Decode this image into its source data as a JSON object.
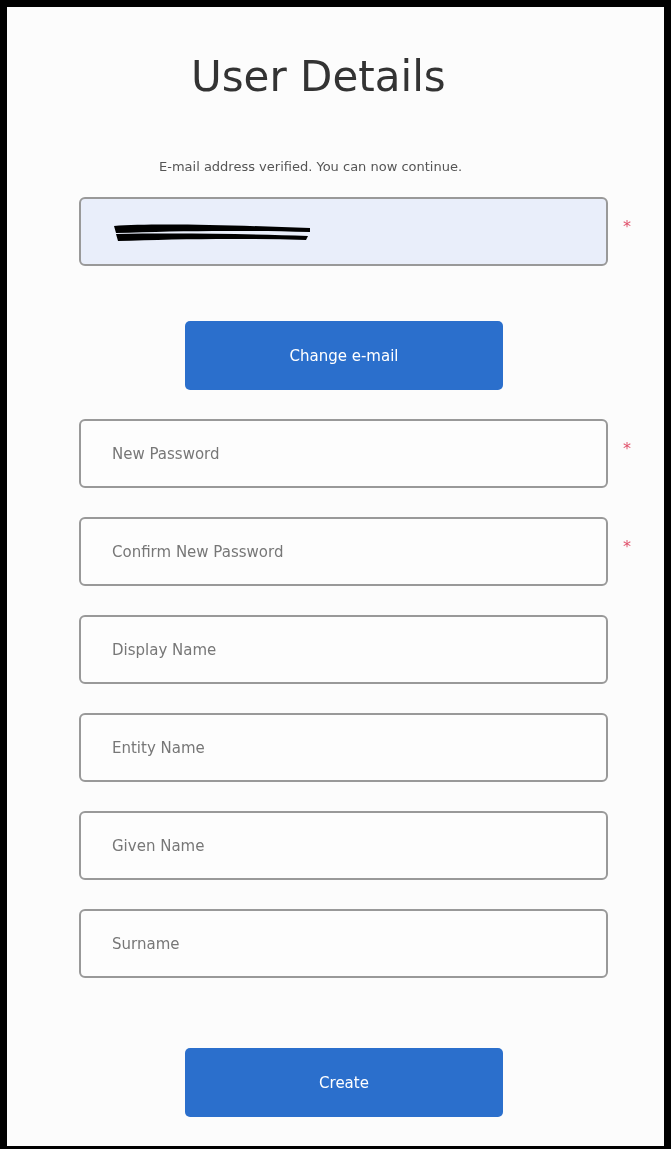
{
  "title": "User Details",
  "message": "E-mail address verified. You can now continue.",
  "email_field": {
    "autofilled": true,
    "redacted": true,
    "required_mark": "*"
  },
  "change_button": "Change e-mail",
  "fields": [
    {
      "placeholder": "New Password",
      "required_mark": "*"
    },
    {
      "placeholder": "Confirm New Password",
      "required_mark": "*"
    },
    {
      "placeholder": "Display Name"
    },
    {
      "placeholder": "Entity Name"
    },
    {
      "placeholder": "Given Name"
    },
    {
      "placeholder": "Surname"
    }
  ],
  "create_button": "Create"
}
